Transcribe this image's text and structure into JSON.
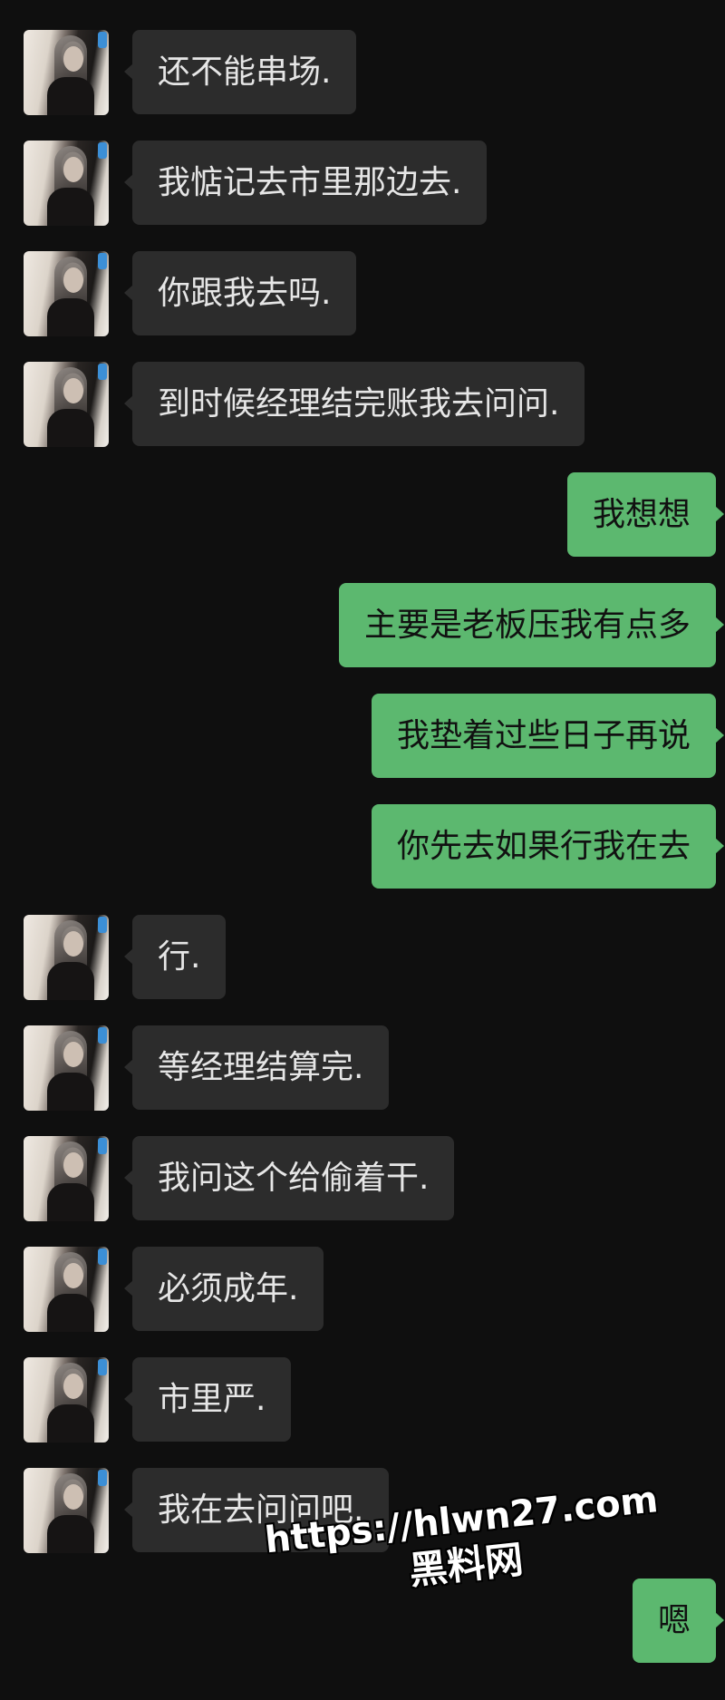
{
  "theme": {
    "background": "#0f0f0f",
    "incoming_bubble": "#2c2c2c",
    "outgoing_bubble": "#5cb86f",
    "incoming_text": "#e6e6e6",
    "outgoing_text": "#111111"
  },
  "messages": [
    "还不能串场.",
    "我惦记去市里那边去.",
    "你跟我去吗.",
    "到时候经理结完账我去问问.",
    "我想想",
    "主要是老板压我有点多",
    "我垫着过些日子再说",
    "你先去如果行我在去",
    "行.",
    "等经理结算完.",
    "我问这个给偷着干.",
    "必须成年.",
    "市里严.",
    "我在去问问吧.",
    "嗯"
  ],
  "watermark": {
    "url": "https://hlwn27.com",
    "site_name": "黑料网"
  }
}
